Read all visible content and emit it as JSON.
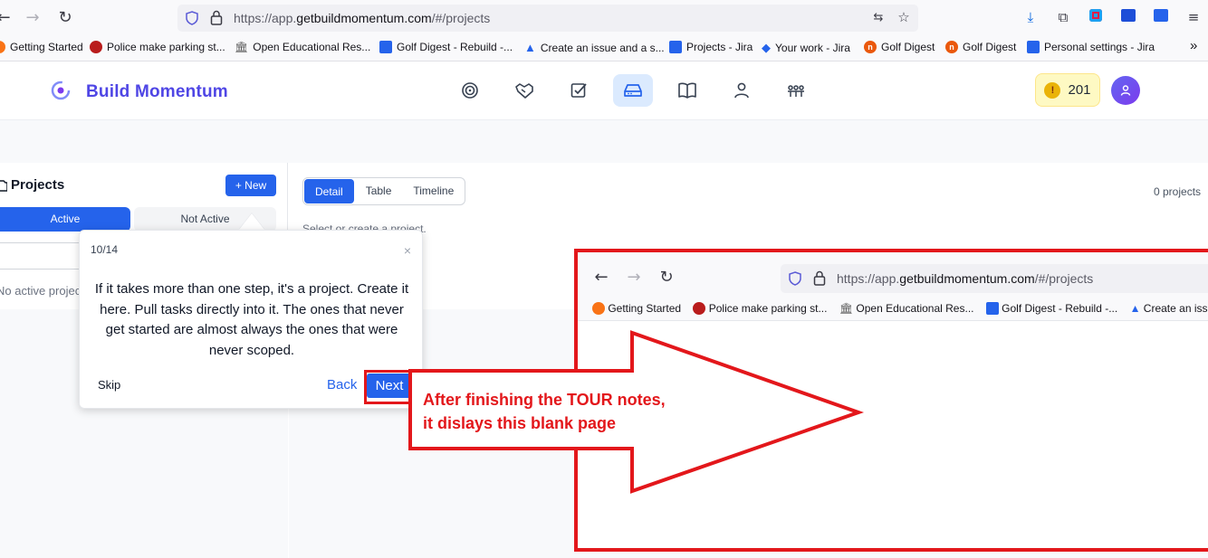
{
  "browser": {
    "url_prefix": "https://app.",
    "url_domain": "getbuildmomentum.com",
    "url_path": "/#/projects",
    "bookmarks": [
      {
        "label": "Getting Started",
        "icon": "firefox-icon"
      },
      {
        "label": "Police make parking st...",
        "icon": "news-icon"
      },
      {
        "label": "Open Educational Res...",
        "icon": "institution-icon"
      },
      {
        "label": "Golf Digest - Rebuild -...",
        "icon": "jira-icon"
      },
      {
        "label": "Create an issue and a s...",
        "icon": "atlassian-icon"
      },
      {
        "label": "Projects - Jira",
        "icon": "jira-icon"
      },
      {
        "label": "Your work - Jira",
        "icon": "jira-diamond-icon"
      },
      {
        "label": "Golf Digest",
        "icon": "golf-digest-icon"
      },
      {
        "label": "Golf Digest",
        "icon": "golf-digest-icon"
      },
      {
        "label": "Personal settings - Jira",
        "icon": "jira-icon"
      }
    ],
    "more_glyph": "»"
  },
  "app": {
    "brand": "Build Momentum",
    "coins": "201",
    "coin_glyph": "!",
    "nav": [
      "target-icon",
      "handshake-icon",
      "checkbox-icon",
      "projects-tray-icon",
      "book-icon",
      "person-icon",
      "team-icon"
    ],
    "active_nav": "projects-tray-icon"
  },
  "sidebar": {
    "title": "Projects",
    "new_button": "+ New",
    "tab_active": "Active",
    "tab_not_active": "Not Active",
    "empty_text": "No active projects"
  },
  "main": {
    "view_tabs": [
      "Detail",
      "Table",
      "Timeline"
    ],
    "selected_view": "Detail",
    "project_count": "0 projects",
    "hint": "Select or create a project."
  },
  "tour": {
    "step": "10/14",
    "close": "×",
    "text": "If it takes more than one step, it's a project. Create it here. Pull tasks directly into it. The ones that never get started are almost always the ones that were never scoped.",
    "skip": "Skip",
    "back": "Back",
    "next": "Next"
  },
  "annotation": {
    "line1": "After finishing the TOUR notes,",
    "line2": "it dislays this blank page",
    "color": "#e3171b"
  },
  "inset": {
    "url_prefix": "https://app.",
    "url_domain": "getbuildmomentum.com",
    "url_path": "/#/projects",
    "bookmarks": [
      "Getting Started",
      "Police make parking st...",
      "Open Educational Res...",
      "Golf Digest - Rebuild -...",
      "Create an issu"
    ]
  }
}
